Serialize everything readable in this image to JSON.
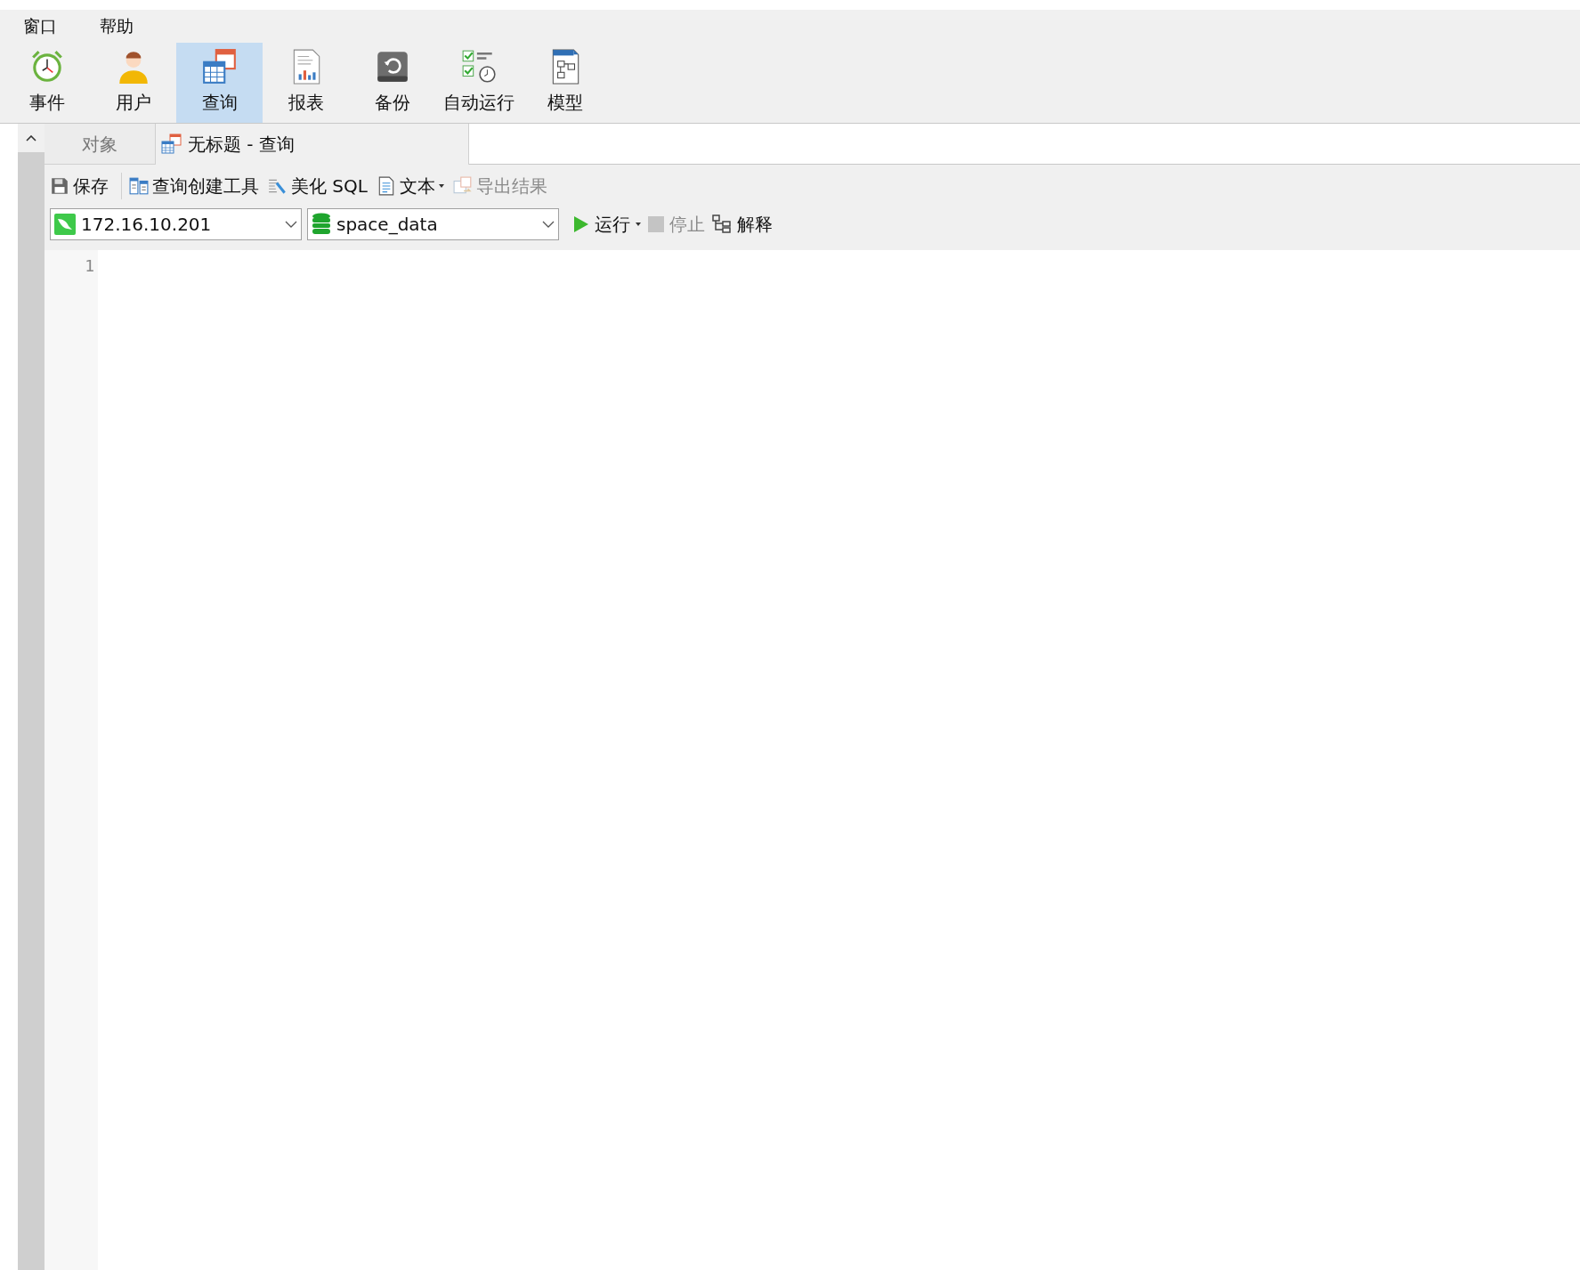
{
  "menu": [
    {
      "label": "窗口"
    },
    {
      "label": "帮助"
    }
  ],
  "ribbon": [
    {
      "label": "事件",
      "selected": false
    },
    {
      "label": "用户",
      "selected": false
    },
    {
      "label": "查询",
      "selected": true
    },
    {
      "label": "报表",
      "selected": false
    },
    {
      "label": "备份",
      "selected": false
    },
    {
      "label": "自动运行",
      "selected": false
    },
    {
      "label": "模型",
      "selected": false
    }
  ],
  "tabs": [
    {
      "label": "对象",
      "selected": false
    },
    {
      "label": "无标题 - 查询",
      "selected": true
    }
  ],
  "toolbar": [
    {
      "label": "保存",
      "disabled": false,
      "dropdown": false
    },
    {
      "label": "查询创建工具",
      "disabled": false,
      "dropdown": false
    },
    {
      "label": "美化 SQL",
      "disabled": false,
      "dropdown": false
    },
    {
      "label": "文本",
      "disabled": false,
      "dropdown": true
    },
    {
      "label": "导出结果",
      "disabled": true,
      "dropdown": false
    }
  ],
  "connection": {
    "value": "172.16.10.201"
  },
  "database": {
    "value": "space_data"
  },
  "run_controls": [
    {
      "label": "运行",
      "disabled": false,
      "dropdown": true
    },
    {
      "label": "停止",
      "disabled": true,
      "dropdown": false
    },
    {
      "label": "解释",
      "disabled": false,
      "dropdown": false
    }
  ],
  "editor": {
    "line_numbers": [
      "1"
    ]
  }
}
